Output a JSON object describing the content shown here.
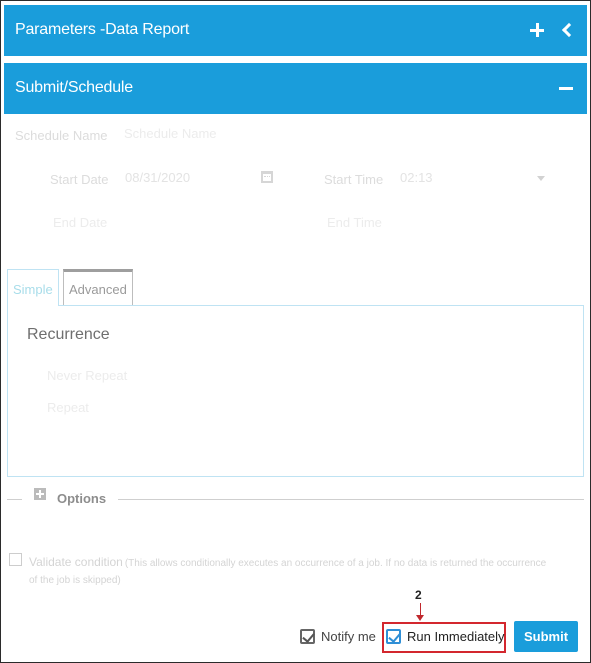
{
  "header": {
    "title": "Parameters -Data Report",
    "add_icon": "plus-icon",
    "collapse_icon": "chevron-left-icon"
  },
  "section": {
    "title": "Submit/Schedule",
    "collapse_icon": "minus-icon"
  },
  "form": {
    "schedule_name_label": "Schedule Name",
    "schedule_name_placeholder": "Schedule Name",
    "start_date_label": "Start Date",
    "start_date_value": "08/31/2020",
    "start_time_label": "Start Time",
    "start_time_value": "02:13",
    "end_date_label": "End Date",
    "end_time_label": "End Time"
  },
  "tabs": [
    {
      "label": "Simple",
      "active": true
    },
    {
      "label": "Advanced",
      "active": false
    }
  ],
  "recurrence": {
    "title": "Recurrence",
    "options": [
      "Never Repeat",
      "Repeat"
    ]
  },
  "options": {
    "label": "Options"
  },
  "validate": {
    "label": "Validate condition",
    "note": "(This allows conditionally executes an occurrence of a job. If no data is returned the occurrence of the job is skipped)"
  },
  "footer": {
    "notify_label": "Notify me",
    "notify_checked": true,
    "run_label": "Run Immediately",
    "run_checked": true,
    "submit_label": "Submit",
    "annotation_number": "2"
  },
  "colors": {
    "accent": "#1a9ddb",
    "highlight": "#d3272e"
  }
}
